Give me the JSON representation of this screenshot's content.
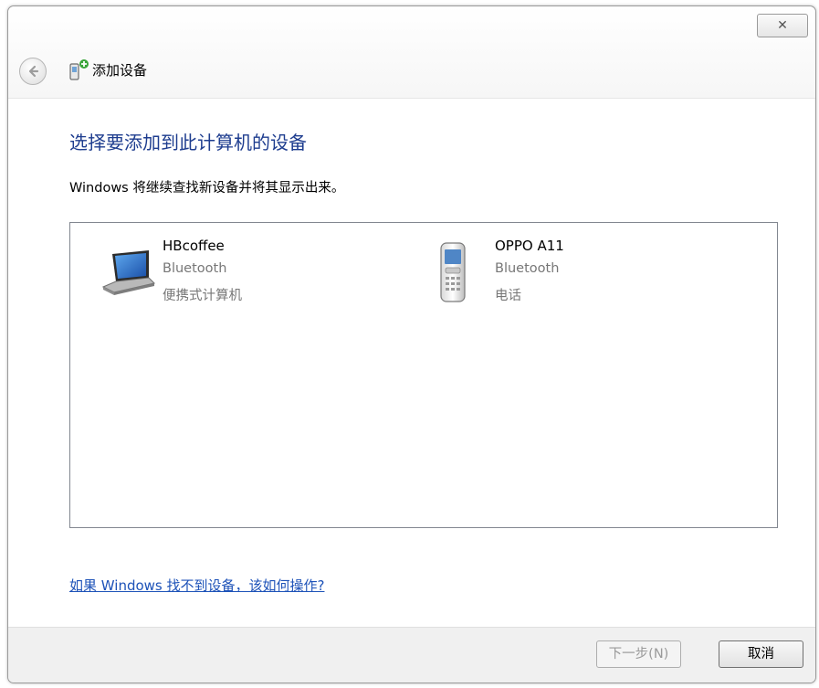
{
  "window": {
    "close_glyph": "✕",
    "title": "添加设备"
  },
  "main": {
    "heading": "选择要添加到此计算机的设备",
    "subtext": "Windows 将继续查找新设备并将其显示出来。",
    "devices": [
      {
        "name": "HBcoffee",
        "type": "Bluetooth",
        "category": "便携式计算机",
        "icon": "laptop-icon"
      },
      {
        "name": "OPPO A11",
        "type": "Bluetooth",
        "category": "电话",
        "icon": "phone-icon"
      }
    ],
    "help_link": "如果 Windows 找不到设备，该如何操作?"
  },
  "footer": {
    "next_label": "下一步(N)",
    "cancel_label": "取消"
  },
  "colors": {
    "heading": "#1e3d8f",
    "link": "#1d52b8",
    "footer_bg": "#f0f0f0"
  }
}
